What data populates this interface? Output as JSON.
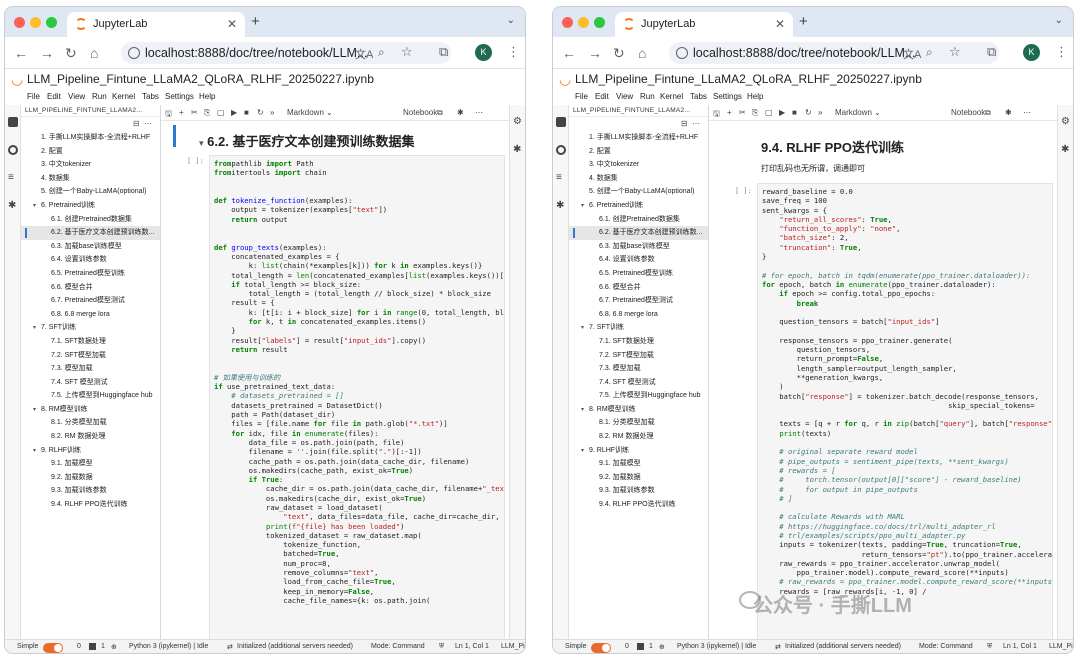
{
  "browser": {
    "tab_title": "JupyterLab",
    "url": "localhost:8888/doc/tree/notebook/LLM...",
    "avatar_letter": "K"
  },
  "app": {
    "doc_title": "LLM_Pipeline_Fintune_LLaMA2_QLoRA_RLHF_20250227.ipynb",
    "menus": [
      "File",
      "Edit",
      "View",
      "Run",
      "Kernel",
      "Tabs",
      "Settings",
      "Help"
    ],
    "sidebar_header": "LLM_PIPELINE_FINTUNE_LLAMA2...",
    "cell_type": "Markdown",
    "kernel_label": "Notebook",
    "accent_color": "#2e79d3",
    "logo_color": "#f37626"
  },
  "toc": [
    {
      "label": "1. 手撕LLM实操脚本-全流程+RLHF",
      "level": 1
    },
    {
      "label": "2. 配置",
      "level": 1
    },
    {
      "label": "3. 中文tokenizer",
      "level": 1
    },
    {
      "label": "4. 数据集",
      "level": 1
    },
    {
      "label": "5. 创建一个Baby-LLaMA(optional)",
      "level": 1
    },
    {
      "label": "6. Pretrained训练",
      "level": 1,
      "expanded": true
    },
    {
      "label": "6.1. 创建Pretrained数据集",
      "level": 2
    },
    {
      "label": "6.2. 基于医疗文本创建预训练数...",
      "level": 2,
      "active": true
    },
    {
      "label": "6.3. 加载base训练模型",
      "level": 2
    },
    {
      "label": "6.4. 设置训练参数",
      "level": 2
    },
    {
      "label": "6.5. Pretrained模型训练",
      "level": 2
    },
    {
      "label": "6.6. 模型合并",
      "level": 2
    },
    {
      "label": "6.7. Pretrained模型测试",
      "level": 2
    },
    {
      "label": "6.8. 6.8 merge lora",
      "level": 2
    },
    {
      "label": "7. SFT训练",
      "level": 1,
      "expanded": true
    },
    {
      "label": "7.1. SFT数据处理",
      "level": 2
    },
    {
      "label": "7.2. SFT模型加载",
      "level": 2
    },
    {
      "label": "7.3. 模型加载",
      "level": 2
    },
    {
      "label": "7.4. SFT 模型测试",
      "level": 2
    },
    {
      "label": "7.5. 上传模型到Huggingface hub",
      "level": 2
    },
    {
      "label": "8. RM模型训练",
      "level": 1,
      "expanded": true
    },
    {
      "label": "8.1. 分类模型加载",
      "level": 2
    },
    {
      "label": "8.2. RM 数据处理",
      "level": 2
    },
    {
      "label": "9. RLHF训练",
      "level": 1,
      "expanded": true
    },
    {
      "label": "9.1. 加载模型",
      "level": 2
    },
    {
      "label": "9.2. 加载数据",
      "level": 2
    },
    {
      "label": "9.3. 加载训练参数",
      "level": 2
    },
    {
      "label": "9.4. RLHF PPO迭代训练",
      "level": 2
    }
  ],
  "status": {
    "mode_label": "Simple",
    "zero": "0",
    "one": "1",
    "kernel": "Python 3 (ipykernel) | Idle",
    "lsp": "Initialized (additional servers needed)",
    "mode": "Mode: Command",
    "position": "Ln 1, Col 1",
    "file": "LLM_Pi"
  },
  "left": {
    "heading": "6.2. 基于医疗文本创建预训练数据集",
    "prompt": "[ ]:",
    "code": [
      [
        [
          "kw",
          "from"
        ],
        [
          "",
          "pathlib "
        ],
        [
          "kw",
          "import"
        ],
        [
          "",
          " Path"
        ]
      ],
      [
        [
          "kw",
          "from"
        ],
        [
          "",
          "itertools "
        ],
        [
          "kw",
          "import"
        ],
        [
          "",
          " chain"
        ]
      ],
      [
        [
          "",
          ""
        ]
      ],
      [
        [
          "",
          ""
        ]
      ],
      [
        [
          "kw",
          "def"
        ],
        [
          "",
          " "
        ],
        [
          "fn",
          "tokenize_function"
        ],
        [
          "",
          "(examples):"
        ]
      ],
      [
        [
          "",
          "    output = tokenizer(examples["
        ],
        [
          "st",
          "\"text\""
        ],
        [
          "",
          "])"
        ]
      ],
      [
        [
          "kw",
          "    return"
        ],
        [
          "",
          " output"
        ]
      ],
      [
        [
          "",
          ""
        ]
      ],
      [
        [
          "",
          ""
        ]
      ],
      [
        [
          "kw",
          "def"
        ],
        [
          "",
          " "
        ],
        [
          "fn",
          "group_texts"
        ],
        [
          "",
          "(examples):"
        ]
      ],
      [
        [
          "",
          "    concatenated_examples = {"
        ]
      ],
      [
        [
          "",
          "        k: "
        ],
        [
          "nm",
          "list"
        ],
        [
          "",
          "(chain(*examples[k])) "
        ],
        [
          "kw",
          "for"
        ],
        [
          "",
          " k "
        ],
        [
          "kw",
          "in"
        ],
        [
          "",
          " examples.keys()}"
        ]
      ],
      [
        [
          "",
          "    total_length = "
        ],
        [
          "nm",
          "len"
        ],
        [
          "",
          "(concatenated_examples["
        ],
        [
          "nm",
          "list"
        ],
        [
          "",
          "(examples.keys())[0]])"
        ]
      ],
      [
        [
          "kw",
          "    if"
        ],
        [
          "",
          " total_length >= block_size:"
        ]
      ],
      [
        [
          "",
          "        total_length = (total_length // block_size) * block_size"
        ]
      ],
      [
        [
          "",
          "    result = {"
        ]
      ],
      [
        [
          "",
          "        k: [t[i: i + block_size] "
        ],
        [
          "kw",
          "for"
        ],
        [
          "",
          " i "
        ],
        [
          "kw",
          "in"
        ],
        [
          "",
          " "
        ],
        [
          "nm",
          "range"
        ],
        [
          "",
          "(0, total_length, bl"
        ]
      ],
      [
        [
          "",
          "        "
        ],
        [
          "kw",
          "for"
        ],
        [
          "",
          " k, t "
        ],
        [
          "kw",
          "in"
        ],
        [
          "",
          " concatenated_examples.items()"
        ]
      ],
      [
        [
          "",
          "    }"
        ]
      ],
      [
        [
          "",
          "    result["
        ],
        [
          "st",
          "\"labels\""
        ],
        [
          "",
          "] = result["
        ],
        [
          "st",
          "\"input_ids\""
        ],
        [
          "",
          "].copy()"
        ]
      ],
      [
        [
          "kw",
          "    return"
        ],
        [
          "",
          " result"
        ]
      ],
      [
        [
          "",
          ""
        ]
      ],
      [
        [
          "",
          ""
        ]
      ],
      [
        [
          "cm",
          "# 如果使用与训练的"
        ]
      ],
      [
        [
          "kw",
          "if"
        ],
        [
          "",
          " use_pretrained_text_data:"
        ]
      ],
      [
        [
          "cm",
          "    # datasets_pretrained = []"
        ]
      ],
      [
        [
          "",
          "    datasets_pretrained = DatasetDict()"
        ]
      ],
      [
        [
          "",
          "    path = Path(dataset_dir)"
        ]
      ],
      [
        [
          "",
          "    files = [file.name "
        ],
        [
          "kw",
          "for"
        ],
        [
          "",
          " file "
        ],
        [
          "kw",
          "in"
        ],
        [
          "",
          " path.glob("
        ],
        [
          "st",
          "\"*.txt\""
        ],
        [
          "",
          ")]"
        ]
      ],
      [
        [
          "kw",
          "    for"
        ],
        [
          "",
          " idx, file "
        ],
        [
          "kw",
          "in"
        ],
        [
          "",
          " "
        ],
        [
          "nm",
          "enumerate"
        ],
        [
          "",
          "(files):"
        ]
      ],
      [
        [
          "",
          "        data_file = os.path.join(path, file)"
        ]
      ],
      [
        [
          "",
          "        filename = "
        ],
        [
          "st",
          "''"
        ],
        [
          "",
          ".join(file.split("
        ],
        [
          "st",
          "\".\""
        ],
        [
          "",
          ")[:-1])"
        ]
      ],
      [
        [
          "",
          "        cache_path = os.path.join(data_cache_dir, filename)"
        ]
      ],
      [
        [
          "",
          "        os.makedirs(cache_path, exist_ok="
        ],
        [
          "kw",
          "True"
        ],
        [
          "",
          ")"
        ]
      ],
      [
        [
          "kw",
          "        if True"
        ],
        [
          "",
          ":"
        ]
      ],
      [
        [
          "",
          "            cache_dir = os.path.join(data_cache_dir, filename+"
        ],
        [
          "st",
          "\"_tex"
        ]
      ],
      [
        [
          "",
          "            os.makedirs(cache_dir, exist_ok="
        ],
        [
          "kw",
          "True"
        ],
        [
          "",
          ")"
        ]
      ],
      [
        [
          "",
          "            raw_dataset = load_dataset("
        ]
      ],
      [
        [
          "",
          "                "
        ],
        [
          "st",
          "\"text\""
        ],
        [
          "",
          ", data_files=data_file, cache_dir=cache_dir,"
        ]
      ],
      [
        [
          "",
          "            "
        ],
        [
          "nm",
          "print"
        ],
        [
          "",
          "("
        ],
        [
          "st",
          "f\"{file} has been loaded\""
        ],
        [
          "",
          ")"
        ]
      ],
      [
        [
          "",
          "            tokenized_dataset = raw_dataset.map("
        ]
      ],
      [
        [
          "",
          "                tokenize_function,"
        ]
      ],
      [
        [
          "",
          "                batched="
        ],
        [
          "kw",
          "True"
        ],
        [
          "",
          ","
        ]
      ],
      [
        [
          "",
          "                num_proc=8,"
        ]
      ],
      [
        [
          "",
          "                remove_columns="
        ],
        [
          "st",
          "\"text\""
        ],
        [
          "",
          ","
        ]
      ],
      [
        [
          "",
          "                load_from_cache_file="
        ],
        [
          "kw",
          "True"
        ],
        [
          "",
          ","
        ]
      ],
      [
        [
          "",
          "                keep_in_memory="
        ],
        [
          "kw",
          "False"
        ],
        [
          "",
          ","
        ]
      ],
      [
        [
          "",
          "                cache_file_names={k: os.path.join("
        ]
      ]
    ]
  },
  "right": {
    "heading": "9.4. RLHF PPO迭代训练",
    "paragraph": "打印乱码也无所谓，调通即可",
    "prompt": "[ ]:",
    "code": [
      [
        [
          "",
          "reward_baseline = 0.0"
        ]
      ],
      [
        [
          "",
          "save_freq = 100"
        ]
      ],
      [
        [
          "",
          "sent_kwargs = {"
        ]
      ],
      [
        [
          "",
          "    "
        ],
        [
          "st",
          "\"return_all_scores\""
        ],
        [
          "",
          ": "
        ],
        [
          "kw",
          "True"
        ],
        [
          "",
          ","
        ]
      ],
      [
        [
          "",
          "    "
        ],
        [
          "st",
          "\"function_to_apply\""
        ],
        [
          "",
          ": "
        ],
        [
          "st",
          "\"none\""
        ],
        [
          "",
          ","
        ]
      ],
      [
        [
          "",
          "    "
        ],
        [
          "st",
          "\"batch_size\""
        ],
        [
          "",
          ": 2,"
        ]
      ],
      [
        [
          "",
          "    "
        ],
        [
          "st",
          "\"truncation\""
        ],
        [
          "",
          ": "
        ],
        [
          "kw",
          "True"
        ],
        [
          "",
          ","
        ]
      ],
      [
        [
          "",
          "}"
        ]
      ],
      [
        [
          "",
          ""
        ]
      ],
      [
        [
          "cm",
          "# for epoch, batch in tqdm(enumerate(ppo_trainer.dataloader)):"
        ]
      ],
      [
        [
          "kw",
          "for"
        ],
        [
          "",
          " epoch, batch "
        ],
        [
          "kw",
          "in"
        ],
        [
          "",
          " "
        ],
        [
          "nm",
          "enumerate"
        ],
        [
          "",
          "(ppo_trainer.dataloader):"
        ]
      ],
      [
        [
          "kw",
          "    if"
        ],
        [
          "",
          " epoch >= config.total_ppo_epochs:"
        ]
      ],
      [
        [
          "kw",
          "        break"
        ]
      ],
      [
        [
          "",
          ""
        ]
      ],
      [
        [
          "",
          "    question_tensors = batch["
        ],
        [
          "st",
          "\"input_ids\""
        ],
        [
          "",
          "]"
        ]
      ],
      [
        [
          "",
          ""
        ]
      ],
      [
        [
          "",
          "    response_tensors = ppo_trainer.generate("
        ]
      ],
      [
        [
          "",
          "        question_tensors,"
        ]
      ],
      [
        [
          "",
          "        return_prompt="
        ],
        [
          "kw",
          "False"
        ],
        [
          "",
          ","
        ]
      ],
      [
        [
          "",
          "        length_sampler=output_length_sampler,"
        ]
      ],
      [
        [
          "",
          "        **generation_kwargs,"
        ]
      ],
      [
        [
          "",
          "    )"
        ]
      ],
      [
        [
          "",
          "    batch["
        ],
        [
          "st",
          "\"response\""
        ],
        [
          "",
          "] = tokenizer.batch_decode(response_tensors,"
        ]
      ],
      [
        [
          "",
          "                                           skip_special_tokens="
        ]
      ],
      [
        [
          "",
          ""
        ]
      ],
      [
        [
          "",
          "    texts = [q + r "
        ],
        [
          "kw",
          "for"
        ],
        [
          "",
          " q, r "
        ],
        [
          "kw",
          "in"
        ],
        [
          "",
          " "
        ],
        [
          "nm",
          "zip"
        ],
        [
          "",
          "(batch["
        ],
        [
          "st",
          "\"query\""
        ],
        [
          "",
          "], batch["
        ],
        [
          "st",
          "\"response\""
        ]
      ],
      [
        [
          "",
          "    "
        ],
        [
          "nm",
          "print"
        ],
        [
          "",
          "(texts)"
        ]
      ],
      [
        [
          "",
          ""
        ]
      ],
      [
        [
          "cm",
          "    # original separate reward model"
        ]
      ],
      [
        [
          "cm",
          "    # pipe_outputs = sentiment_pipe(texts, **sent_kwargs)"
        ]
      ],
      [
        [
          "cm",
          "    # rewards = ["
        ]
      ],
      [
        [
          "cm",
          "    #     torch.tensor(output[0][\"score\"] - reward_baseline)"
        ]
      ],
      [
        [
          "cm",
          "    #     for output in pipe_outputs"
        ]
      ],
      [
        [
          "cm",
          "    # ]"
        ]
      ],
      [
        [
          "",
          ""
        ]
      ],
      [
        [
          "cm",
          "    # calculate Rewards with MARL"
        ]
      ],
      [
        [
          "cm",
          "    # https://huggingface.co/docs/trl/multi_adapter_rl"
        ]
      ],
      [
        [
          "cm",
          "    # trl/examples/scripts/ppo_multi_adapter.py"
        ]
      ],
      [
        [
          "",
          "    inputs = tokenizer(texts, padding="
        ],
        [
          "kw",
          "True"
        ],
        [
          "",
          ", truncation="
        ],
        [
          "kw",
          "True"
        ],
        [
          "",
          ","
        ]
      ],
      [
        [
          "",
          "                       return_tensors="
        ],
        [
          "st",
          "\"pt\""
        ],
        [
          "",
          ").to(ppo_trainer.accelera"
        ]
      ],
      [
        [
          "",
          "    raw_rewards = ppo_trainer.accelerator.unwrap_model("
        ]
      ],
      [
        [
          "",
          "        ppo_trainer.model).compute_reward_score(**inputs)"
        ]
      ],
      [
        [
          "cm",
          "    # raw_rewards = ppo_trainer.model.compute_reward_score(**inputs"
        ]
      ],
      [
        [
          "",
          "    rewards = [raw_rewards[i, -1, 0] /"
        ]
      ]
    ]
  },
  "watermark": "公众号 · 手撕LLM"
}
